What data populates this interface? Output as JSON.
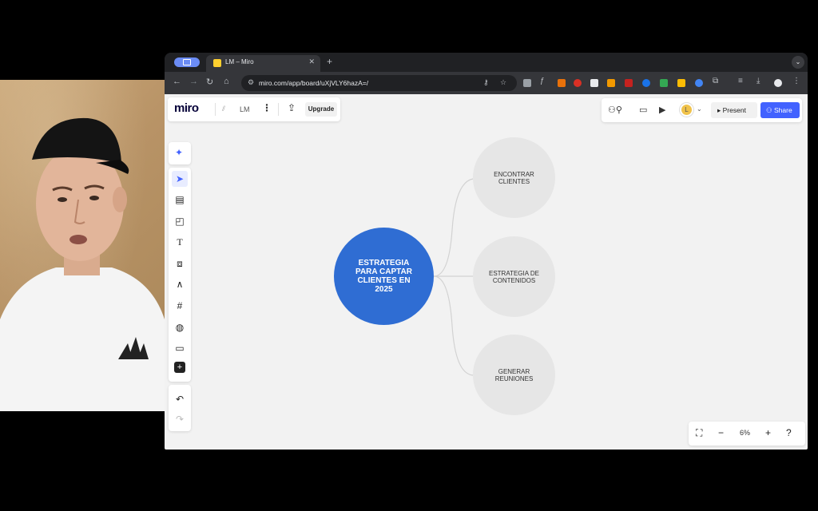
{
  "browser": {
    "tab_title": "LM – Miro",
    "tab_close": "✕",
    "new_tab": "+",
    "url": "miro.com/app/board/uXjVLY6hazA=/"
  },
  "miro": {
    "logo": "miro",
    "board_name": "LM",
    "upgrade_label": "Upgrade",
    "present_label": "Present",
    "share_label": "Share",
    "avatar_initial": "L",
    "zoom_level": "6%",
    "accent_color": "#4262ff",
    "toolbar_tools": [
      "select",
      "templates",
      "sticky-note",
      "text",
      "shapes",
      "pen",
      "frame",
      "color-palette",
      "comment",
      "more"
    ]
  },
  "mindmap": {
    "central": "ESTRATEGIA PARA CAPTAR CLIENTES EN 2025",
    "central_color": "#2f6dd3",
    "children": [
      "ENCONTRAR CLIENTES",
      "ESTRATEGIA DE CONTENIDOS",
      "GENERAR REUNIONES"
    ]
  }
}
